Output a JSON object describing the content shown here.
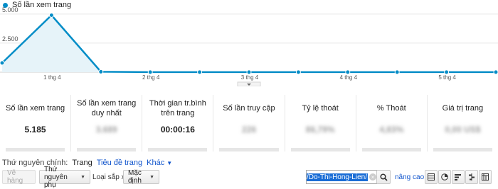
{
  "chart_data": {
    "type": "area",
    "series": [
      {
        "name": "Số lần xem trang",
        "values": [
          800,
          4900,
          40,
          5,
          5,
          5,
          5,
          5,
          5,
          5,
          5
        ]
      }
    ],
    "x_tick_labels": [
      "1 thg 4",
      "2 thg 4",
      "3 thg 4",
      "4 thg 4",
      "5 thg 4"
    ],
    "y_tick_labels": [
      "5.000",
      "2.500"
    ],
    "ylim": [
      0,
      5600
    ],
    "grid": true,
    "legend": "top-left",
    "line_color": "#058dc7",
    "fill_color": "#e6f3f9"
  },
  "legend": {
    "label": "Số lần xem trang"
  },
  "metrics": [
    {
      "label": "Số lần xem trang",
      "value": "5.185",
      "blurred": false
    },
    {
      "label": "Số lần xem trang duy nhất",
      "value": "3.689",
      "blurred": true
    },
    {
      "label": "Thời gian tr.bình trên trang",
      "value": "00:00:16",
      "blurred": false
    },
    {
      "label": "Số lần truy cập",
      "value": "226",
      "blurred": true
    },
    {
      "label": "Tỷ lệ thoát",
      "value": "86,79%",
      "blurred": true
    },
    {
      "label": "% Thoát",
      "value": "4,83%",
      "blurred": true
    },
    {
      "label": "Giá trị trang",
      "value": "0,00 US$",
      "blurred": true
    }
  ],
  "dimension": {
    "label": "Thứ nguyên chính:",
    "active": "Trang",
    "link": "Tiêu đề trang",
    "other": "Khác"
  },
  "toolbar": {
    "row_button": "Vẽ hàng",
    "secondary_dim": "Thứ nguyên phụ",
    "sort_label": "Loại sắp xếp:",
    "sort_value": "Mặc định",
    "search_value": "/view/Do-Thi-Hong-Lien",
    "advanced": "nâng cao"
  }
}
